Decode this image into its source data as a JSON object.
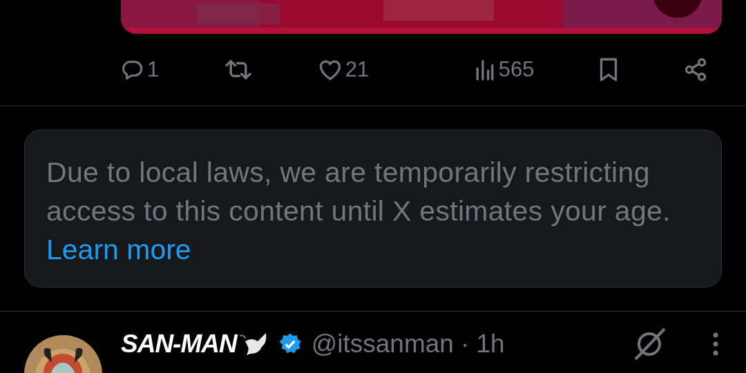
{
  "actions": [
    {
      "kind": "reply",
      "count": "1"
    },
    {
      "kind": "repost"
    },
    {
      "kind": "like",
      "count": "21"
    },
    {
      "kind": "views",
      "count": "565"
    },
    {
      "kind": "bookmark"
    },
    {
      "kind": "share"
    }
  ],
  "notice": {
    "text": "Due to local laws, we are temporarily restricting access to this content until X estimates your age.",
    "link": "Learn more"
  },
  "next_post": {
    "name": "SAN-MAN",
    "verified": true,
    "handle": "@itssanman",
    "time": "· 1h"
  }
}
